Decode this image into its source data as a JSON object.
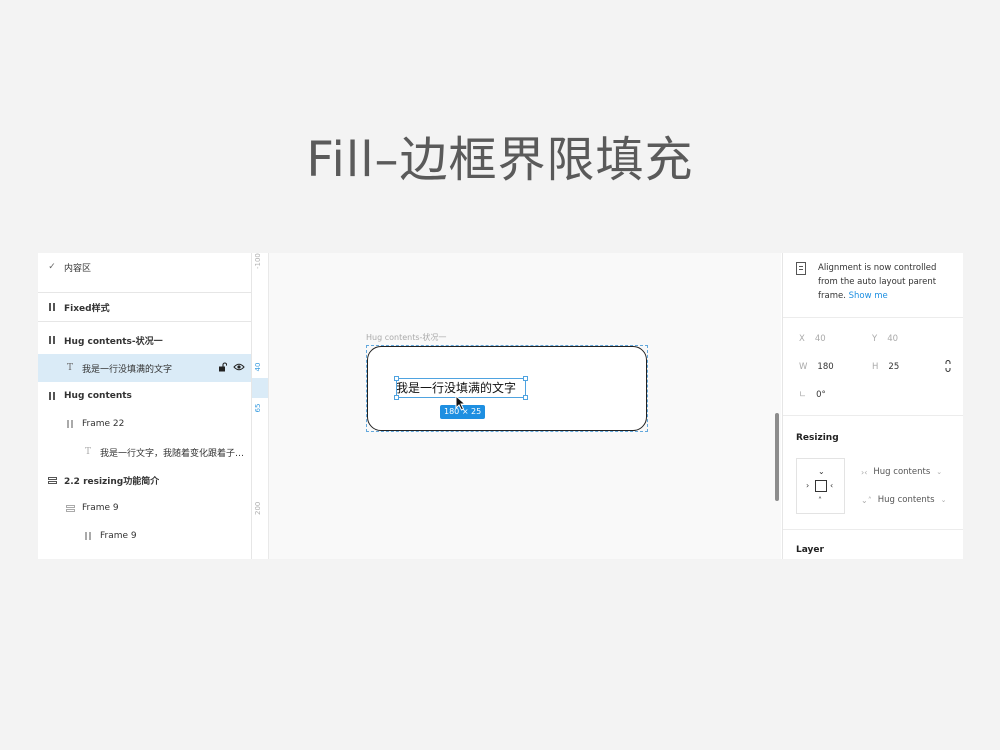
{
  "slide": {
    "title": "Fill–边框界限填充"
  },
  "layers": {
    "top_item": "内容区",
    "items": [
      {
        "label": "Fixed样式"
      },
      {
        "label": "Hug contents-状况一"
      },
      {
        "label": "我是一行没填满的文字"
      },
      {
        "label": "Hug contents"
      },
      {
        "label": "Frame 22"
      },
      {
        "label": "我是一行文字，我随着变化跟着子层..."
      },
      {
        "label": "2.2 resizing功能简介"
      },
      {
        "label": "Frame 9"
      },
      {
        "label": "Frame 9"
      }
    ]
  },
  "ruler": {
    "marks": [
      "-100",
      "40",
      "65",
      "200"
    ]
  },
  "canvas": {
    "frame_label": "Hug contents-状况一",
    "text": "我是一行没填满的文字",
    "dimensions": "180 × 25"
  },
  "inspector": {
    "notice": "Alignment is now controlled from the auto layout parent frame.",
    "notice_link": "Show me",
    "x_label": "X",
    "x_value": "40",
    "y_label": "Y",
    "y_value": "40",
    "w_label": "W",
    "w_value": "180",
    "h_label": "H",
    "h_value": "25",
    "rotation": "0°",
    "resizing_title": "Resizing",
    "horizontal_resizing": "Hug contents",
    "vertical_resizing": "Hug contents",
    "layer_title": "Layer"
  },
  "colors": {
    "accent": "#1e8fe1",
    "selection": "#daebf7"
  }
}
